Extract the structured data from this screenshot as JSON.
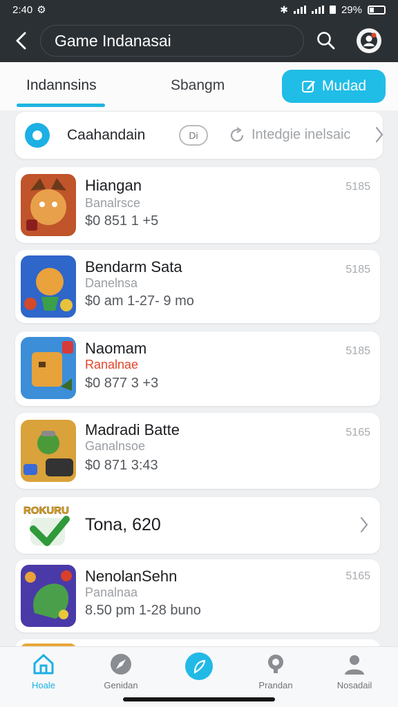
{
  "status": {
    "time": "2:40",
    "battery": "29%"
  },
  "header": {
    "title": "Game Indanasai"
  },
  "tabs": [
    {
      "label": "Indannsins"
    },
    {
      "label": "Sbangm"
    }
  ],
  "action_button": {
    "label": "Mudad"
  },
  "filter": {
    "label": "Caahandain",
    "chip": "Di",
    "hint": "Intedgie inelsaic"
  },
  "games": [
    {
      "name": "Hiangan",
      "sub": "Banalrsce",
      "price": "$0 851 1 +5",
      "code": "5185"
    },
    {
      "name": "Bendarm Sata",
      "sub": "Danelnsa",
      "price": "$0 am 1-27- 9 mo",
      "code": "5185"
    },
    {
      "name": "Naomam",
      "sub": "Ranalnae",
      "price": "$0 877 3 +3",
      "code": "5185"
    },
    {
      "name": "Madradi Batte",
      "sub": "Ganalnsoe",
      "price": "$0 871 3:43",
      "code": "5165"
    }
  ],
  "promo": {
    "badge": "ROKURU",
    "title": "Tona, 620"
  },
  "games_more": [
    {
      "name": "NenolanSehn",
      "sub": "Panalnaa",
      "price": "8.50 pm 1-28 buno",
      "code": "5165"
    }
  ],
  "nav": [
    {
      "label": "Hoale"
    },
    {
      "label": "Genidan"
    },
    {
      "label": "Prandan"
    },
    {
      "label": "Nosadail"
    }
  ],
  "colors": {
    "accent": "#1cb0e4",
    "header_bg": "#2b3034",
    "sale_red": "#e0452c"
  }
}
